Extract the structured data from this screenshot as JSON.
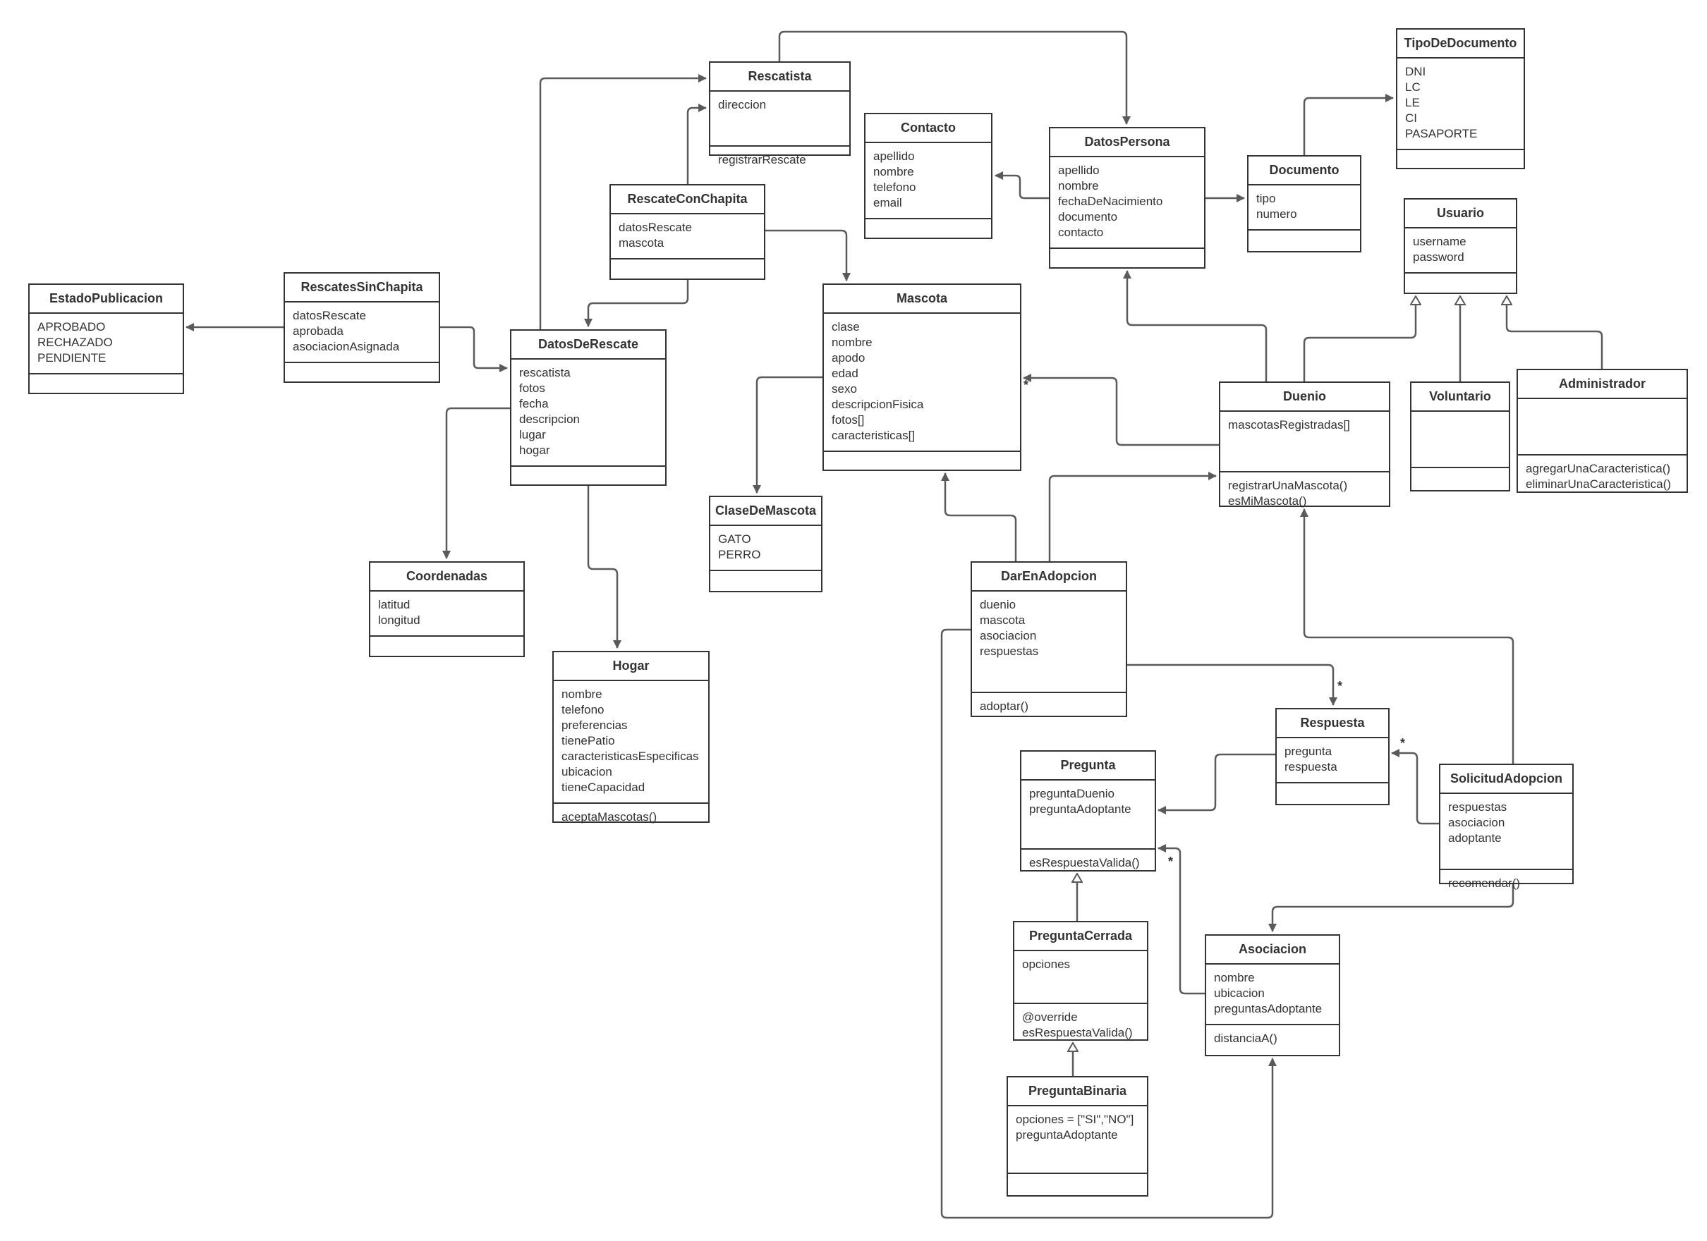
{
  "diagram": {
    "type": "UML class diagram",
    "classes": {
      "EstadoPublicacion": {
        "name": "EstadoPublicacion",
        "attributes": [
          "APROBADO",
          "RECHAZADO",
          "PENDIENTE"
        ],
        "methods": []
      },
      "RescatesSinChapita": {
        "name": "RescatesSinChapita",
        "attributes": [
          "datosRescate",
          "aprobada",
          "asociacionAsignada"
        ],
        "methods": []
      },
      "DatosDeRescate": {
        "name": "DatosDeRescate",
        "attributes": [
          "rescatista",
          "fotos",
          "fecha",
          "descripcion",
          "lugar",
          "hogar"
        ],
        "methods": []
      },
      "Rescatista": {
        "name": "Rescatista",
        "attributes": [
          "direccion"
        ],
        "methods": [
          "registrarRescate"
        ]
      },
      "RescateConChapita": {
        "name": "RescateConChapita",
        "attributes": [
          "datosRescate",
          "mascota"
        ],
        "methods": []
      },
      "Contacto": {
        "name": "Contacto",
        "attributes": [
          "apellido",
          "nombre",
          "telefono",
          "email"
        ],
        "methods": []
      },
      "DatosPersona": {
        "name": "DatosPersona",
        "attributes": [
          "apellido",
          "nombre",
          "fechaDeNacimiento",
          "documento",
          "contacto"
        ],
        "methods": []
      },
      "Documento": {
        "name": "Documento",
        "attributes": [
          "tipo",
          "numero"
        ],
        "methods": []
      },
      "TipoDeDocumento": {
        "name": "TipoDeDocumento",
        "attributes": [
          "DNI",
          "LC",
          "LE",
          "CI",
          "PASAPORTE"
        ],
        "methods": []
      },
      "Usuario": {
        "name": "Usuario",
        "attributes": [
          "username",
          "password"
        ],
        "methods": []
      },
      "Mascota": {
        "name": "Mascota",
        "attributes": [
          "clase",
          "nombre",
          "apodo",
          "edad",
          "sexo",
          "descripcionFisica",
          "fotos[]",
          "caracteristicas[]"
        ],
        "methods": []
      },
      "ClaseDeMascota": {
        "name": "ClaseDeMascota",
        "attributes": [
          "GATO",
          "PERRO"
        ],
        "methods": []
      },
      "Coordenadas": {
        "name": "Coordenadas",
        "attributes": [
          "latitud",
          "longitud"
        ],
        "methods": []
      },
      "Hogar": {
        "name": "Hogar",
        "attributes": [
          "nombre",
          "telefono",
          "preferencias",
          "tienePatio",
          "caracteristicasEspecificas",
          "ubicacion",
          "tieneCapacidad"
        ],
        "methods": [
          "aceptaMascotas()"
        ]
      },
      "Duenio": {
        "name": "Duenio",
        "attributes": [
          "mascotasRegistradas[]"
        ],
        "methods": [
          "registrarUnaMascota()",
          "esMiMascota()"
        ]
      },
      "Voluntario": {
        "name": "Voluntario",
        "attributes": [],
        "methods": []
      },
      "Administrador": {
        "name": "Administrador",
        "attributes": [],
        "methods": [
          "agregarUnaCaracteristica()",
          "eliminarUnaCaracteristica()"
        ]
      },
      "DarEnAdopcion": {
        "name": "DarEnAdopcion",
        "attributes": [
          "duenio",
          "mascota",
          "asociacion",
          "respuestas"
        ],
        "methods": [
          "adoptar()"
        ]
      },
      "Respuesta": {
        "name": "Respuesta",
        "attributes": [
          "pregunta",
          "respuesta"
        ],
        "methods": []
      },
      "Pregunta": {
        "name": "Pregunta",
        "attributes": [
          "preguntaDuenio",
          "preguntaAdoptante"
        ],
        "methods": [
          "esRespuestaValida()"
        ]
      },
      "SolicitudAdopcion": {
        "name": "SolicitudAdopcion",
        "attributes": [
          "respuestas",
          "asociacion",
          "adoptante"
        ],
        "methods": [
          "recomendar()"
        ]
      },
      "PreguntaCerrada": {
        "name": "PreguntaCerrada",
        "attributes": [
          "opciones"
        ],
        "methods": [
          "@override",
          "esRespuestaValida()"
        ]
      },
      "Asociacion": {
        "name": "Asociacion",
        "attributes": [
          "nombre",
          "ubicacion",
          "preguntasAdoptante"
        ],
        "methods": [
          "distanciaA()"
        ]
      },
      "PreguntaBinaria": {
        "name": "PreguntaBinaria",
        "attributes": [
          "opciones = [\"SI\",\"NO\"]",
          "preguntaAdoptante"
        ],
        "methods": []
      }
    },
    "relations": [
      {
        "from": "RescatesSinChapita",
        "to": "EstadoPublicacion",
        "kind": "association"
      },
      {
        "from": "RescatesSinChapita",
        "to": "DatosDeRescate",
        "kind": "association"
      },
      {
        "from": "DatosDeRescate",
        "to": "Rescatista",
        "kind": "association"
      },
      {
        "from": "RescateConChapita",
        "to": "Rescatista",
        "kind": "association"
      },
      {
        "from": "RescateConChapita",
        "to": "DatosDeRescate",
        "kind": "association"
      },
      {
        "from": "RescateConChapita",
        "to": "Mascota",
        "kind": "association"
      },
      {
        "from": "Rescatista",
        "to": "DatosPersona",
        "kind": "association"
      },
      {
        "from": "DatosPersona",
        "to": "Contacto",
        "kind": "association"
      },
      {
        "from": "DatosPersona",
        "to": "Documento",
        "kind": "association"
      },
      {
        "from": "Documento",
        "to": "TipoDeDocumento",
        "kind": "association"
      },
      {
        "from": "DatosDeRescate",
        "to": "Coordenadas",
        "kind": "association"
      },
      {
        "from": "DatosDeRescate",
        "to": "Hogar",
        "kind": "association"
      },
      {
        "from": "Mascota",
        "to": "ClaseDeMascota",
        "kind": "association"
      },
      {
        "from": "Duenio",
        "to": "DatosPersona",
        "kind": "association"
      },
      {
        "from": "Duenio",
        "to": "Mascota",
        "kind": "association",
        "multiplicity": "*"
      },
      {
        "from": "Duenio",
        "to": "Usuario",
        "kind": "generalization"
      },
      {
        "from": "Voluntario",
        "to": "Usuario",
        "kind": "generalization"
      },
      {
        "from": "Administrador",
        "to": "Usuario",
        "kind": "generalization"
      },
      {
        "from": "DarEnAdopcion",
        "to": "Mascota",
        "kind": "association"
      },
      {
        "from": "DarEnAdopcion",
        "to": "Duenio",
        "kind": "association"
      },
      {
        "from": "DarEnAdopcion",
        "to": "Respuesta",
        "kind": "association",
        "multiplicity": "*"
      },
      {
        "from": "DarEnAdopcion",
        "to": "Asociacion",
        "kind": "association"
      },
      {
        "from": "SolicitudAdopcion",
        "to": "Duenio",
        "kind": "association"
      },
      {
        "from": "SolicitudAdopcion",
        "to": "Respuesta",
        "kind": "association",
        "multiplicity": "*"
      },
      {
        "from": "SolicitudAdopcion",
        "to": "Asociacion",
        "kind": "association"
      },
      {
        "from": "Respuesta",
        "to": "Pregunta",
        "kind": "association"
      },
      {
        "from": "Asociacion",
        "to": "Pregunta",
        "kind": "association",
        "multiplicity": "*"
      },
      {
        "from": "PreguntaCerrada",
        "to": "Pregunta",
        "kind": "generalization"
      },
      {
        "from": "PreguntaBinaria",
        "to": "PreguntaCerrada",
        "kind": "generalization"
      }
    ],
    "multiplicity_label": "*"
  }
}
